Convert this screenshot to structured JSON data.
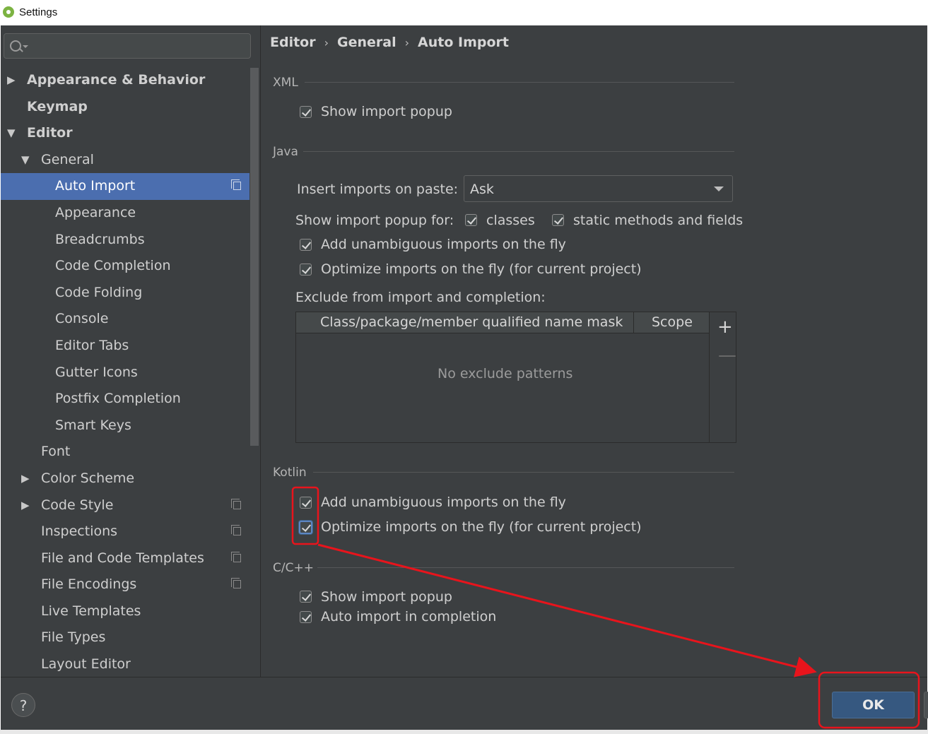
{
  "window": {
    "title": "Settings",
    "icon": "android-studio-icon"
  },
  "search": {
    "placeholder": ""
  },
  "sidebar": {
    "items": [
      {
        "label": "Appearance & Behavior",
        "level": 0,
        "arrow": "collapsed",
        "bold": true,
        "selected": false,
        "copy_icon": false
      },
      {
        "label": "Keymap",
        "level": 0,
        "arrow": "none",
        "bold": true,
        "selected": false,
        "copy_icon": false
      },
      {
        "label": "Editor",
        "level": 0,
        "arrow": "expanded",
        "bold": true,
        "selected": false,
        "copy_icon": false
      },
      {
        "label": "General",
        "level": 1,
        "arrow": "expanded",
        "bold": false,
        "selected": false,
        "copy_icon": false
      },
      {
        "label": "Auto Import",
        "level": 2,
        "arrow": "none",
        "bold": false,
        "selected": true,
        "copy_icon": true
      },
      {
        "label": "Appearance",
        "level": 2,
        "arrow": "none",
        "bold": false,
        "selected": false,
        "copy_icon": false
      },
      {
        "label": "Breadcrumbs",
        "level": 2,
        "arrow": "none",
        "bold": false,
        "selected": false,
        "copy_icon": false
      },
      {
        "label": "Code Completion",
        "level": 2,
        "arrow": "none",
        "bold": false,
        "selected": false,
        "copy_icon": false
      },
      {
        "label": "Code Folding",
        "level": 2,
        "arrow": "none",
        "bold": false,
        "selected": false,
        "copy_icon": false
      },
      {
        "label": "Console",
        "level": 2,
        "arrow": "none",
        "bold": false,
        "selected": false,
        "copy_icon": false
      },
      {
        "label": "Editor Tabs",
        "level": 2,
        "arrow": "none",
        "bold": false,
        "selected": false,
        "copy_icon": false
      },
      {
        "label": "Gutter Icons",
        "level": 2,
        "arrow": "none",
        "bold": false,
        "selected": false,
        "copy_icon": false
      },
      {
        "label": "Postfix Completion",
        "level": 2,
        "arrow": "none",
        "bold": false,
        "selected": false,
        "copy_icon": false
      },
      {
        "label": "Smart Keys",
        "level": 2,
        "arrow": "none",
        "bold": false,
        "selected": false,
        "copy_icon": false
      },
      {
        "label": "Font",
        "level": 1,
        "arrow": "none",
        "bold": false,
        "selected": false,
        "copy_icon": false
      },
      {
        "label": "Color Scheme",
        "level": 1,
        "arrow": "collapsed",
        "bold": false,
        "selected": false,
        "copy_icon": false
      },
      {
        "label": "Code Style",
        "level": 1,
        "arrow": "collapsed",
        "bold": false,
        "selected": false,
        "copy_icon": true
      },
      {
        "label": "Inspections",
        "level": 1,
        "arrow": "none",
        "bold": false,
        "selected": false,
        "copy_icon": true
      },
      {
        "label": "File and Code Templates",
        "level": 1,
        "arrow": "none",
        "bold": false,
        "selected": false,
        "copy_icon": true
      },
      {
        "label": "File Encodings",
        "level": 1,
        "arrow": "none",
        "bold": false,
        "selected": false,
        "copy_icon": true
      },
      {
        "label": "Live Templates",
        "level": 1,
        "arrow": "none",
        "bold": false,
        "selected": false,
        "copy_icon": false
      },
      {
        "label": "File Types",
        "level": 1,
        "arrow": "none",
        "bold": false,
        "selected": false,
        "copy_icon": false
      },
      {
        "label": "Layout Editor",
        "level": 1,
        "arrow": "none",
        "bold": false,
        "selected": false,
        "copy_icon": false
      }
    ]
  },
  "breadcrumb": [
    "Editor",
    "General",
    "Auto Import"
  ],
  "xml": {
    "section": "XML",
    "show_import_popup": {
      "label": "Show import popup",
      "checked": true
    }
  },
  "java": {
    "section": "Java",
    "insert_imports_label": "Insert imports on paste:",
    "insert_imports_value": "Ask",
    "show_popup_for_label": "Show import popup for:",
    "classes": {
      "label": "classes",
      "checked": true
    },
    "static_methods": {
      "label": "static methods and fields",
      "checked": true
    },
    "add_unambiguous": {
      "label": "Add unambiguous imports on the fly",
      "checked": true
    },
    "optimize_imports": {
      "label": "Optimize imports on the fly (for current project)",
      "checked": true
    },
    "exclude_label": "Exclude from import and completion:",
    "exclude_table": {
      "columns": [
        "Class/package/member qualified name mask",
        "Scope"
      ],
      "empty_text": "No exclude patterns",
      "add_button": "+",
      "remove_button": "—"
    }
  },
  "kotlin": {
    "section": "Kotlin",
    "add_unambiguous": {
      "label": "Add unambiguous imports on the fly",
      "checked": true
    },
    "optimize_imports": {
      "label": "Optimize imports on the fly (for current project)",
      "checked": true
    }
  },
  "cpp": {
    "section": "C/C++",
    "show_import_popup": {
      "label": "Show import popup",
      "checked": true
    },
    "auto_import": {
      "label": "Auto import in completion",
      "checked": true
    }
  },
  "footer": {
    "help_label": "?",
    "ok_label": "OK"
  },
  "annotation": {
    "color": "#e8141c"
  },
  "theme": {
    "background": "#3c3f41",
    "selection": "#4b6eaf",
    "ok_button": "#365880"
  }
}
